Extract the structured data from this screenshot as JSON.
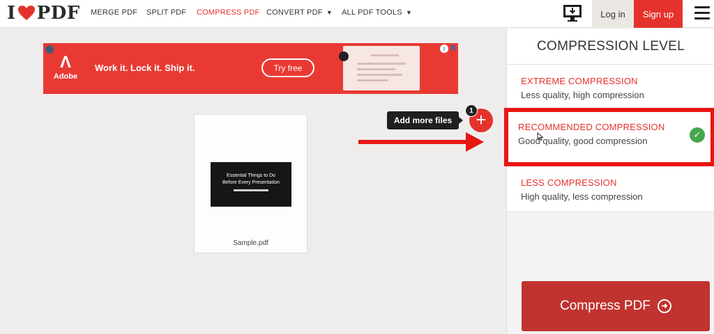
{
  "logo": {
    "left": "I",
    "right": "PDF"
  },
  "nav": {
    "merge": "MERGE PDF",
    "split": "SPLIT PDF",
    "compress": "COMPRESS PDF",
    "convert": "CONVERT PDF",
    "all_tools": "ALL PDF TOOLS",
    "caret": "▼",
    "login": "Log in",
    "signup": "Sign up"
  },
  "ad": {
    "brand": "Adobe",
    "headline": "Work it. Lock it. Ship it.",
    "cta": "Try free"
  },
  "file": {
    "thumb_line1": "Essential Things to Do",
    "thumb_line2": "Before Every Presentation",
    "name": "Sample.pdf"
  },
  "add_files": {
    "tooltip": "Add more files",
    "count": "1",
    "plus": "+"
  },
  "panel": {
    "title": "COMPRESSION LEVEL",
    "options": [
      {
        "title": "EXTREME COMPRESSION",
        "desc": "Less quality, high compression"
      },
      {
        "title": "RECOMMENDED COMPRESSION",
        "desc": "Good quality, good compression"
      },
      {
        "title": "LESS COMPRESSION",
        "desc": "High quality, less compression"
      }
    ],
    "check": "✓",
    "button": "Compress PDF",
    "button_icon": "➜"
  },
  "colors": {
    "brand": "#e5322d",
    "highlight": "#e81612",
    "check": "#45a650"
  },
  "icons": [
    "heart-icon",
    "desktop-download-icon",
    "hamburger-menu-icon",
    "plus-icon",
    "check-icon",
    "arrow-right-icon",
    "cursor-icon",
    "ad-choices-icon",
    "close-icon"
  ]
}
